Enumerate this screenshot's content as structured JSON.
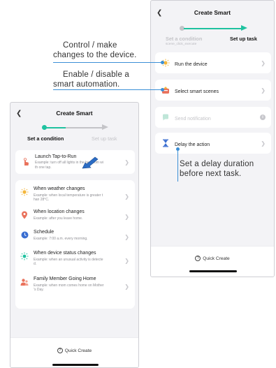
{
  "colors": {
    "accent": "#1fc2a0",
    "annotation_line": "#3b8fd6",
    "cursor": "#2b6cc4",
    "inactive_step": "#c4c4c8"
  },
  "right_screen": {
    "title": "Create Smart",
    "back_icon": "chevron-left-icon",
    "steps": [
      {
        "label": "Set a condition",
        "sublabel": "scene_click_execute",
        "active": false
      },
      {
        "label": "Set up task",
        "active": true
      }
    ],
    "tasks": [
      {
        "label": "Run the device",
        "icon": "sun-icon",
        "enabled": true
      },
      {
        "label": "Select smart scenes",
        "icon": "scene-icon",
        "enabled": true
      },
      {
        "label": "Send notification",
        "icon": "notification-icon",
        "enabled": false,
        "badge": "i"
      },
      {
        "label": "Delay the action",
        "icon": "hourglass-icon",
        "enabled": true
      }
    ],
    "quick_create": "Quick Create"
  },
  "left_screen": {
    "title": "Create Smart",
    "back_icon": "chevron-left-icon",
    "steps": [
      {
        "label": "Set a condition",
        "active": true
      },
      {
        "label": "Set up task",
        "active": false
      }
    ],
    "launch_card": {
      "title": "Launch Tap-to-Run",
      "desc_line1": "Example: turn off all lights in the bedroom wi",
      "desc_line2": "th one tap.",
      "icon": "hand-tap-icon"
    },
    "conditions": [
      {
        "title": "When weather changes",
        "desc_line1": "Example: when local temperature is greater t",
        "desc_line2": "han 28°C.",
        "icon": "sun-icon"
      },
      {
        "title": "When location changes",
        "desc_line1": "Example: after you leave home.",
        "desc_line2": "",
        "icon": "location-pin-icon"
      },
      {
        "title": "Schedule",
        "desc_line1": "Example: 7:00 a.m. every morning.",
        "desc_line2": "",
        "icon": "clock-icon"
      },
      {
        "title": "When device status changes",
        "desc_line1": "Example: when an unusual activity is detecte",
        "desc_line2": "d.",
        "icon": "device-status-icon"
      },
      {
        "title": "Family Member Going Home",
        "desc_line1": "Example: when mom comes home on Mother",
        "desc_line2": "'s Day.",
        "icon": "family-member-icon"
      }
    ],
    "quick_create": "Quick Create"
  },
  "annotations": {
    "control_line1": "Control / make",
    "control_line2": "changes to the device.",
    "enable_line1": "Enable / disable a",
    "enable_line2": "smart automation.",
    "delay_line1": "Set a delay duration",
    "delay_line2": "before next task."
  }
}
